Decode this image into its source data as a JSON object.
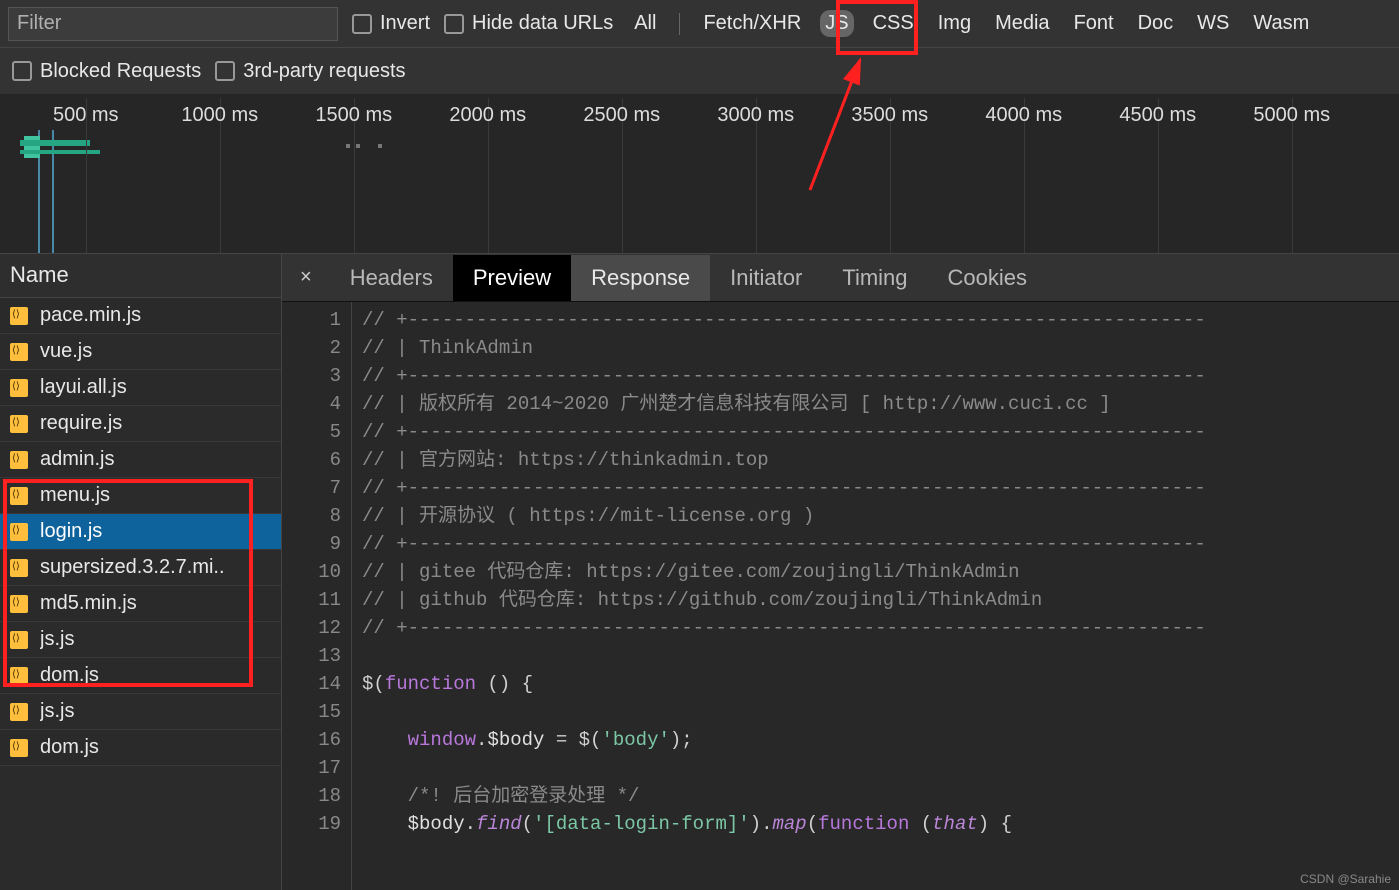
{
  "filter": {
    "placeholder": "Filter"
  },
  "checkboxes": {
    "invert": "Invert",
    "hide_data_urls": "Hide data URLs",
    "blocked": "Blocked Requests",
    "third_party": "3rd-party requests"
  },
  "type_filters": [
    "All",
    "Fetch/XHR",
    "JS",
    "CSS",
    "Img",
    "Media",
    "Font",
    "Doc",
    "WS",
    "Wasm"
  ],
  "type_filter_active": "JS",
  "timeline": {
    "ticks": [
      "500 ms",
      "1000 ms",
      "1500 ms",
      "2000 ms",
      "2500 ms",
      "3000 ms",
      "3500 ms",
      "4000 ms",
      "4500 ms",
      "5000 ms"
    ]
  },
  "name_header": "Name",
  "files": [
    {
      "name": "pace.min.js"
    },
    {
      "name": "vue.js"
    },
    {
      "name": "layui.all.js"
    },
    {
      "name": "require.js"
    },
    {
      "name": "admin.js"
    },
    {
      "name": "menu.js"
    },
    {
      "name": "login.js",
      "selected": true
    },
    {
      "name": "supersized.3.2.7.mi.."
    },
    {
      "name": "md5.min.js"
    },
    {
      "name": "js.js"
    },
    {
      "name": "dom.js"
    },
    {
      "name": "js.js"
    },
    {
      "name": "dom.js"
    }
  ],
  "detail_tabs": {
    "close": "×",
    "items": [
      "Headers",
      "Preview",
      "Response",
      "Initiator",
      "Timing",
      "Cookies"
    ],
    "active": "Preview",
    "hover": "Response"
  },
  "code": {
    "lines": [
      "// +----------------------------------------------------------------------",
      "// | ThinkAdmin",
      "// +----------------------------------------------------------------------",
      "// | 版权所有 2014~2020 广州楚才信息科技有限公司 [ http://www.cuci.cc ]",
      "// +----------------------------------------------------------------------",
      "// | 官方网站: https://thinkadmin.top",
      "// +----------------------------------------------------------------------",
      "// | 开源协议 ( https://mit-license.org )",
      "// +----------------------------------------------------------------------",
      "// | gitee 代码仓库: https://gitee.com/zoujingli/ThinkAdmin",
      "// | github 代码仓库: https://github.com/zoujingli/ThinkAdmin",
      "// +----------------------------------------------------------------------",
      "",
      "$(function () {",
      "",
      "    window.$body = $('body');",
      "",
      "    /*! 后台加密登录处理 */",
      "    $body.find('[data-login-form]').map(function (that) {"
    ]
  },
  "watermark": "CSDN @Sarahie"
}
